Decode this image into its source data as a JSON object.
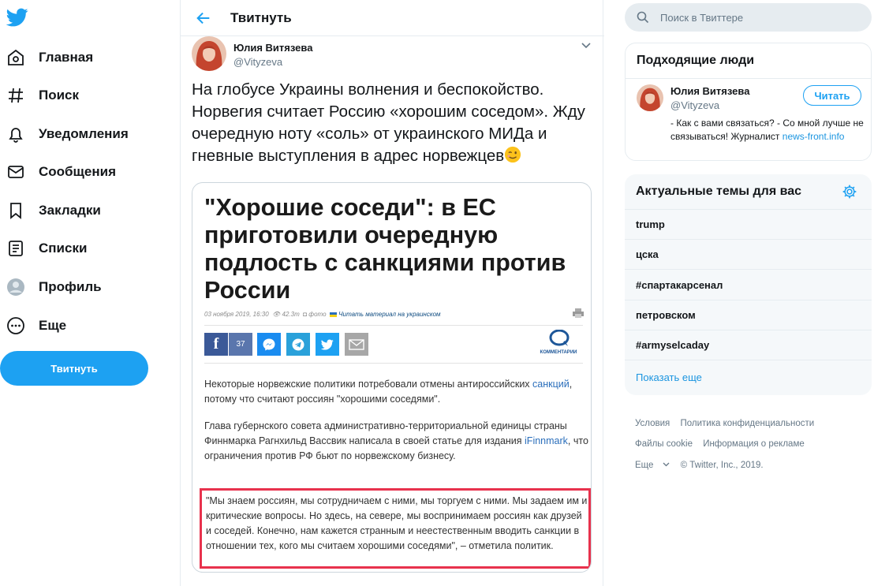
{
  "nav": {
    "items": [
      {
        "label": "Главная",
        "icon": "home-icon"
      },
      {
        "label": "Поиск",
        "icon": "hashtag-icon"
      },
      {
        "label": "Уведомления",
        "icon": "bell-icon"
      },
      {
        "label": "Сообщения",
        "icon": "envelope-icon"
      },
      {
        "label": "Закладки",
        "icon": "bookmark-icon"
      },
      {
        "label": "Списки",
        "icon": "list-icon"
      },
      {
        "label": "Профиль",
        "icon": "avatar-icon"
      },
      {
        "label": "Еще",
        "icon": "more-icon"
      }
    ],
    "tweet_button": "Твитнуть"
  },
  "header": {
    "title": "Твитнуть"
  },
  "tweet": {
    "author_name": "Юлия Витязева",
    "author_handle": "@Vityzeva",
    "text": "На глобусе Украины волнения и беспокойство. Норвегия считает Россию «хорошим соседом». Жду очередную ноту «соль» от украинского МИДа и гневные выступления в адрес норвежцев"
  },
  "article": {
    "title": "\"Хорошие соседи\": в ЕС приготовили очередную подлость с санкциями против России",
    "date": "03 ноября 2019, 16:30",
    "views": "42.3т",
    "photo": "фото",
    "read_ua": "Читать материал на украинском",
    "fb_count": "37",
    "comments_label": "КОММЕНТАРИИ",
    "p1_a": "Некоторые норвежские политики потребовали отмены антироссийских ",
    "p1_link": "санкций",
    "p1_b": ", потому что считают россиян \"хорошими соседями\".",
    "p2_a": "Глава губернского совета административно-территориальной единицы страны Финнмарка Рагнхильд Вассвик написала в своей статье для издания ",
    "p2_link": "iFinnmark",
    "p2_b": ", что ограничения против РФ бьют по норвежскому бизнесу.",
    "quote": "\"Мы знаем россиян, мы сотрудничаем с ними, мы торгуем с ними. Мы задаем им и критические вопросы. Но здесь, на севере, мы воспринимаем россиян как друзей и соседей. Конечно, нам кажется странным и неестественным вводить санкции в отношении тех, кого мы считаем хорошими соседями\", – отметила политик."
  },
  "search": {
    "placeholder": "Поиск в Твиттере"
  },
  "who_to_follow": {
    "title": "Подходящие люди",
    "name": "Юлия Витязева",
    "handle": "@Vityzeva",
    "follow_label": "Читать",
    "bio": "- Как с вами связаться? - Со мной лучше не связываться! Журналист",
    "bio_link": "news-front.info"
  },
  "trends": {
    "title": "Актуальные темы для вас",
    "items": [
      "trump",
      "цска",
      "#спартакарсенал",
      "петровском",
      "#armyselcaday"
    ],
    "show_more": "Показать еще"
  },
  "footer": {
    "terms": "Условия",
    "privacy": "Политика конфиденциальности",
    "cookies": "Файлы cookie",
    "ads": "Информация о рекламе",
    "more": "Еще",
    "copyright": "© Twitter, Inc., 2019."
  },
  "colors": {
    "accent": "#1da1f2",
    "highlight_border": "#e8324d"
  }
}
